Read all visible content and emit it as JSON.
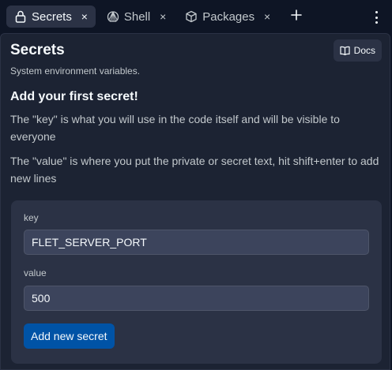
{
  "tabs": [
    {
      "label": "Secrets",
      "icon": "lock-icon",
      "active": true
    },
    {
      "label": "Shell",
      "icon": "shell-icon",
      "active": false
    },
    {
      "label": "Packages",
      "icon": "package-icon",
      "active": false
    }
  ],
  "tab_close_glyph": "×",
  "add_tab_icon": "plus-icon",
  "menu_icon": "kebab-menu-icon",
  "header": {
    "title": "Secrets",
    "subtitle": "System environment variables.",
    "docs_label": "Docs"
  },
  "intro": {
    "heading": "Add your first secret!",
    "para1": "The \"key\" is what you will use in the code itself and will be visible to everyone",
    "para2": "The \"value\" is where you put the private or secret text, hit shift+enter to add new lines"
  },
  "form": {
    "key_label": "key",
    "key_value": "FLET_SERVER_PORT",
    "value_label": "value",
    "value_value": "500",
    "submit_label": "Add new secret"
  },
  "colors": {
    "background": "#0e1525",
    "panel": "#1c2333",
    "surface": "#2b3245",
    "input": "#3c445c",
    "primary_button": "#0053a6",
    "text": "#f5f9fc",
    "muted_text": "#c2c8cc"
  }
}
